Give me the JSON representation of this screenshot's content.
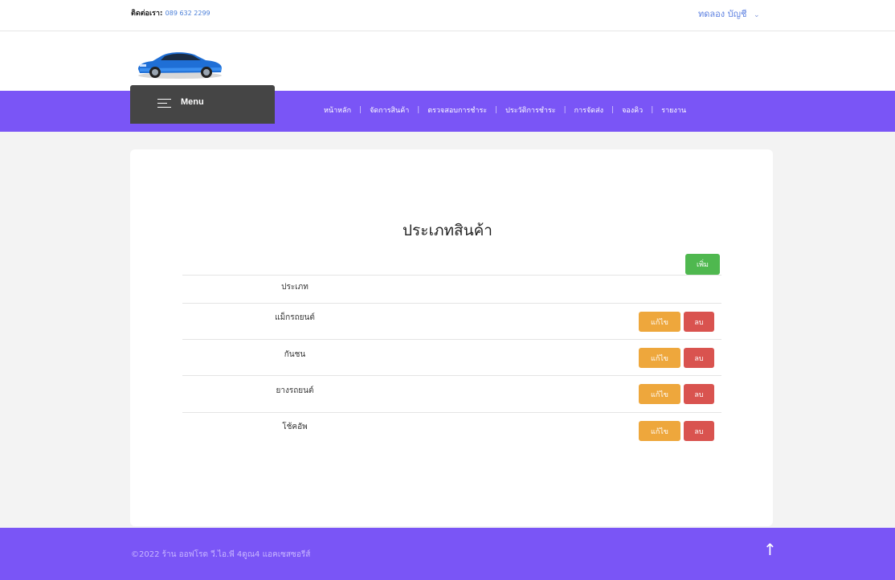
{
  "topbar": {
    "contact_label": "ติดต่อเรา:",
    "contact_phone": "089 632 2299",
    "account_label": "ทดลอง บัญชี",
    "account_icon": "chevron-down-icon"
  },
  "logo": {
    "icon": "car-logo"
  },
  "menu": {
    "label": "Menu",
    "icon": "hamburger-icon"
  },
  "nav": {
    "items": [
      {
        "label": "หน้าหลัก"
      },
      {
        "label": "จัดการสินค้า"
      },
      {
        "label": "ตรวจสอบการชำระ"
      },
      {
        "label": "ประวัติการชำระ"
      },
      {
        "label": "การจัดส่ง"
      },
      {
        "label": "จองคิว"
      },
      {
        "label": "รายงาน"
      }
    ]
  },
  "content": {
    "title": "ประเภทสินค้า",
    "add_label": "เพิ่ม",
    "column_header": "ประเภท",
    "rows": [
      {
        "name": "แม็กรถยนต์",
        "edit": "แก้ไข",
        "delete": "ลบ"
      },
      {
        "name": "กันชน",
        "edit": "แก้ไข",
        "delete": "ลบ"
      },
      {
        "name": "ยางรถยนต์",
        "edit": "แก้ไข",
        "delete": "ลบ"
      },
      {
        "name": "โช้คอัพ",
        "edit": "แก้ไข",
        "delete": "ลบ"
      }
    ]
  },
  "footer": {
    "copyright": "©2022 ร้าน ออฟโรด วี.ไอ.พี 4ดูณ4 แอคเซสซอรีส์",
    "up_icon": "arrow-up-icon"
  },
  "colors": {
    "nav_bg": "#7a55f6",
    "menu_bg": "#454545",
    "add": "#4fb84f",
    "edit": "#eea73c",
    "delete": "#d9534f"
  }
}
